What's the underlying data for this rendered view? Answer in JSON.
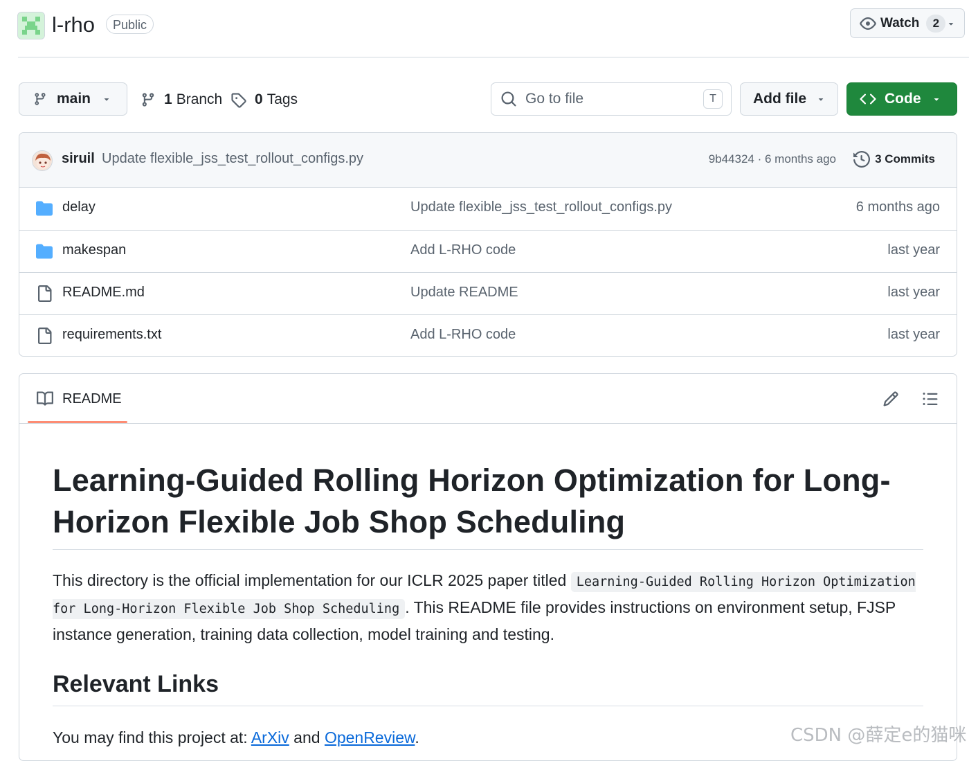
{
  "repo": {
    "name": "l-rho",
    "visibility": "Public"
  },
  "watch": {
    "label": "Watch",
    "count": "2"
  },
  "toolbar": {
    "branch": "main",
    "branches_count": "1",
    "branches_label": "Branch",
    "tags_count": "0",
    "tags_label": "Tags",
    "goto_placeholder": "Go to file",
    "goto_shortcut": "T",
    "add_file": "Add file",
    "code": "Code"
  },
  "latest_commit": {
    "author": "siruil",
    "message": "Update flexible_jss_test_rollout_configs.py",
    "meta": "9b44324 · 6 months ago",
    "commits_label": "3 Commits"
  },
  "files": [
    {
      "name": "delay",
      "type": "folder",
      "message": "Update flexible_jss_test_rollout_configs.py",
      "time": "6 months ago"
    },
    {
      "name": "makespan",
      "type": "folder",
      "message": "Add L-RHO code",
      "time": "last year"
    },
    {
      "name": "README.md",
      "type": "file",
      "message": "Update README",
      "time": "last year"
    },
    {
      "name": "requirements.txt",
      "type": "file",
      "message": "Add L-RHO code",
      "time": "last year"
    }
  ],
  "readme": {
    "tab_label": "README",
    "title": "Learning-Guided Rolling Horizon Optimization for Long-Horizon Flexible Job Shop Scheduling",
    "intro_before": "This directory is the official implementation for our ICLR 2025 paper titled ",
    "intro_code": "Learning-Guided Rolling Horizon Optimization for Long-Horizon Flexible Job Shop Scheduling",
    "intro_after": ". This README file provides instructions on environment setup, FJSP instance generation, training data collection, model training and testing.",
    "links_heading": "Relevant Links",
    "links_before": "You may find this project at: ",
    "link1": "ArXiv",
    "links_mid": " and ",
    "link2": "OpenReview",
    "links_after": "."
  },
  "watermark": "CSDN @薛定e的猫咪",
  "colors": {
    "accent_green": "#1f883d",
    "folder_blue": "#54aeff",
    "link_blue": "#0969da",
    "tab_underline": "#fd8c73"
  }
}
